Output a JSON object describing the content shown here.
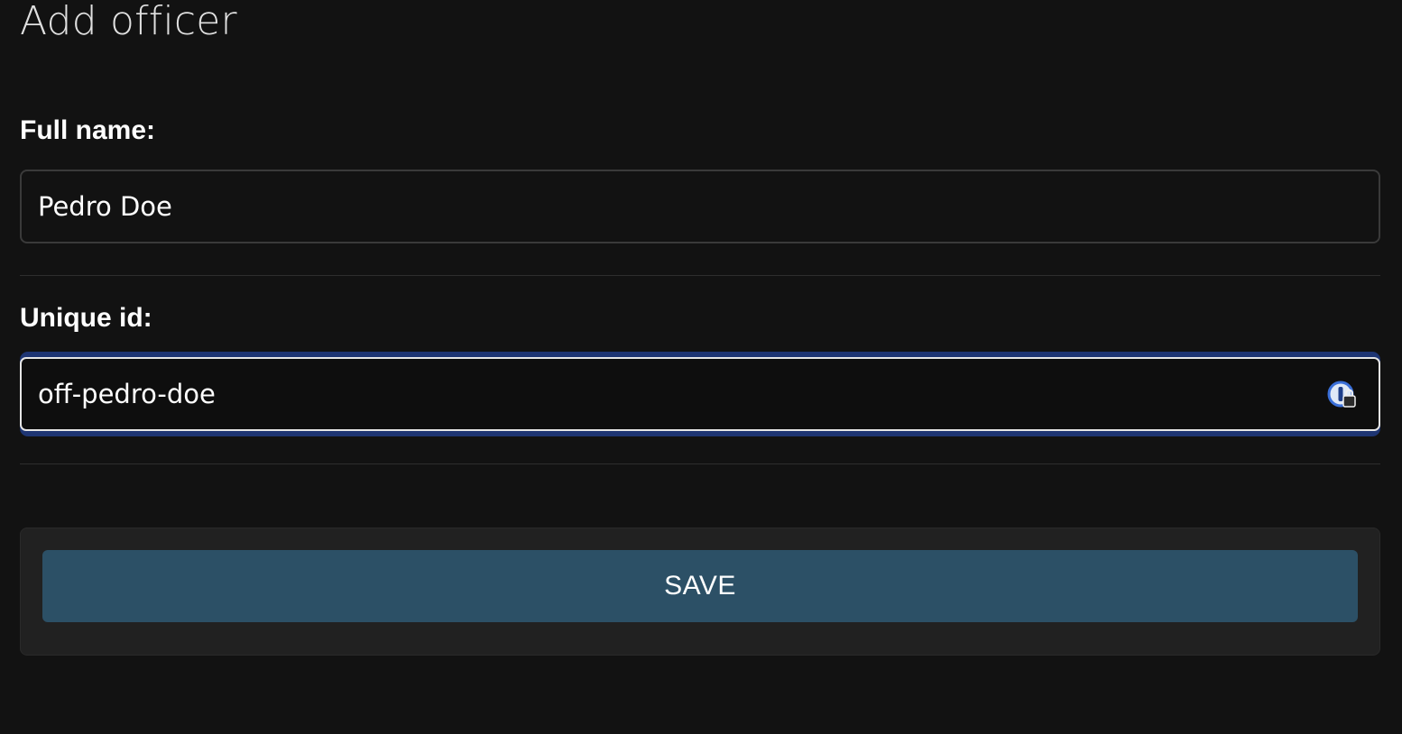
{
  "page": {
    "title": "Add officer"
  },
  "form": {
    "full_name": {
      "label": "Full name:",
      "value": "Pedro Doe"
    },
    "unique_id": {
      "label": "Unique id:",
      "value": "off-pedro-doe",
      "focused": true,
      "trailing_icon": "password-manager-icon"
    },
    "save_label": "SAVE"
  },
  "colors": {
    "background": "#121212",
    "panel": "#212121",
    "button": "#2c5066",
    "focus_ring": "#1e3573",
    "text": "#ffffff"
  }
}
